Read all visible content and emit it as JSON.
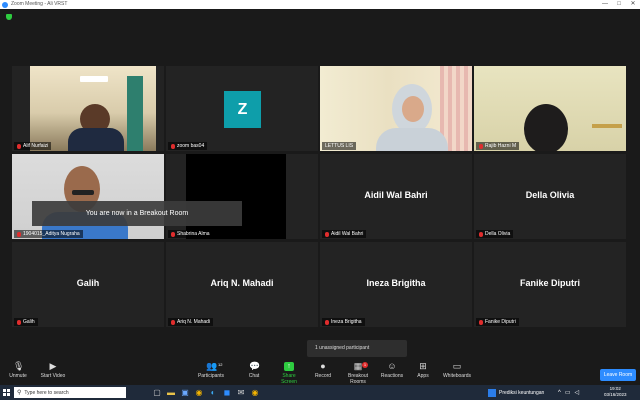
{
  "window": {
    "title": "Zoom Meeting - Ali VRST",
    "controls": [
      "—",
      "□",
      "✕"
    ]
  },
  "tiles": [
    {
      "name": "Alif Nurfaizi",
      "big_name": "",
      "muted": true,
      "active": false,
      "video": "photo-room"
    },
    {
      "name": "zoom bas04",
      "big_name": "",
      "muted": true,
      "active": false,
      "avatar_letter": "Z"
    },
    {
      "name": "LETTUS LIS",
      "big_name": "",
      "muted": false,
      "active": true,
      "video": "photo-hijab"
    },
    {
      "name": "Rajib Hazni M",
      "big_name": "",
      "muted": true,
      "active": false,
      "video": "photo-dark"
    },
    {
      "name": "1904015_Aditya Nugraha",
      "big_name": "",
      "muted": true,
      "active": false,
      "video": "photo-boy"
    },
    {
      "name": "Shabrina Alma",
      "big_name": "",
      "muted": true,
      "active": false,
      "video": "black"
    },
    {
      "name": "Aidil Wal Bahri",
      "big_name": "Aidil Wal Bahri",
      "muted": true,
      "active": false
    },
    {
      "name": "Della Olivia",
      "big_name": "Della Olivia",
      "muted": true,
      "active": false
    },
    {
      "name": "Galih",
      "big_name": "Galih",
      "muted": true,
      "active": false
    },
    {
      "name": "Ariq N. Mahadi",
      "big_name": "Ariq N. Mahadi",
      "muted": true,
      "active": false
    },
    {
      "name": "Ineza Brigitha",
      "big_name": "Ineza Brigitha",
      "muted": true,
      "active": false
    },
    {
      "name": "Fanike Diputri",
      "big_name": "Fanike Diputri",
      "muted": true,
      "active": false
    }
  ],
  "breakout_banner": "You are now in a Breakout Room",
  "unassigned_text": "1 unassigned participant",
  "toolbar": {
    "unmute": "Unmute",
    "start_video": "Start Video",
    "participants": "Participants",
    "participants_count": "12",
    "chat": "Chat",
    "share_screen": "Share Screen",
    "record": "Record",
    "breakout_rooms": "Breakout Rooms",
    "breakout_badge": "1",
    "reactions": "Reactions",
    "apps": "Apps",
    "whiteboards": "Whiteboards",
    "leave": "Leave Room"
  },
  "taskbar": {
    "search_placeholder": "Type here to search",
    "weather_text": "Prediksi keuntungan",
    "time": "19:02",
    "date": "03/16/2023"
  },
  "colors": {
    "accent": "#2d8cff",
    "active_border": "#e8e23a",
    "share_green": "#2ecc40",
    "muted_red": "#e02d2d",
    "avatar_teal": "#0e9eaa"
  }
}
